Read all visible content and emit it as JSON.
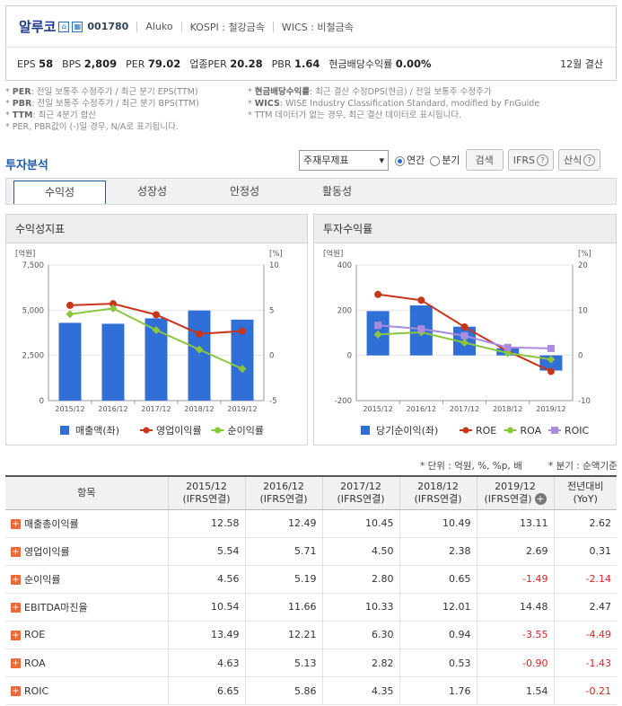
{
  "company": {
    "name": "알루코",
    "code": "001780",
    "eng": "Aluko",
    "market": "KOSPI : 철강금속",
    "wics": "WICS : 비철금속",
    "icon1": "home-icon",
    "icon2": "building-icon"
  },
  "summary": {
    "eps_label": "EPS",
    "eps": "58",
    "bps_label": "BPS",
    "bps": "2,809",
    "per_label": "PER",
    "per": "79.02",
    "iper_label": "업종PER",
    "iper": "20.28",
    "pbr_label": "PBR",
    "pbr": "1.64",
    "div_label": "현금배당수익률",
    "div": "0.00%",
    "fy": "12월 결산"
  },
  "notes_left": [
    {
      "k": "PER",
      "v": ": 전일 보통주 수정주가 / 최근 분기 EPS(TTM)"
    },
    {
      "k": "PBR",
      "v": ": 전일 보통주 수정주가 / 최근 분기 BPS(TTM)"
    },
    {
      "k": "TTM",
      "v": ": 최근 4분기 합산"
    },
    {
      "k": "",
      "v": "PER, PBR값이 (-)일 경우, N/A로 표기됩니다."
    }
  ],
  "notes_right": [
    {
      "k": "현금배당수익률",
      "v": ": 최근 결산 수정DPS(현금) / 전일 보통주 수정주가"
    },
    {
      "k": "WICS",
      "v": ": WISE Industry Classification Standard, modified by FnGuide"
    },
    {
      "k": "",
      "v": "TTM 데이터가 없는 경우, 최근 결산 데이터로 표시됩니다."
    }
  ],
  "section_title": "투자분석",
  "controls": {
    "select": "주재무제표",
    "annual": "연간",
    "quarter": "분기",
    "search": "검색",
    "ifrs": "IFRS",
    "formula": "산식",
    "q": "?"
  },
  "tabs": [
    "수익성",
    "성장성",
    "안정성",
    "활동성"
  ],
  "charts_titles": [
    "수익성지표",
    "투자수익률"
  ],
  "chart_data": [
    {
      "type": "bar",
      "title": "수익성지표",
      "categories": [
        "2015/12",
        "2016/12",
        "2017/12",
        "2018/12",
        "2019/12"
      ],
      "left_unit": "[억원]",
      "right_unit": "[%]",
      "yleft_ticks": [
        "7,500",
        "5,000",
        "2,500",
        "0"
      ],
      "yright_ticks": [
        "10",
        "5",
        "0",
        "-5"
      ],
      "ylim_left": [
        0,
        7500
      ],
      "ylim_right": [
        -5,
        10
      ],
      "series": [
        {
          "name": "매출액(좌)",
          "kind": "bar",
          "axis": "left",
          "color": "#2f6fd6",
          "values": [
            4300,
            4250,
            4550,
            4980,
            4480
          ]
        },
        {
          "name": "영업이익률",
          "kind": "line",
          "axis": "right",
          "color": "#c8361a",
          "values": [
            5.54,
            5.71,
            4.5,
            2.38,
            2.69
          ]
        },
        {
          "name": "순이익률",
          "kind": "line",
          "axis": "right",
          "color": "#8cc63e",
          "values": [
            4.56,
            5.19,
            2.8,
            0.65,
            -1.49
          ]
        }
      ]
    },
    {
      "type": "bar",
      "title": "투자수익률",
      "categories": [
        "2015/12",
        "2016/12",
        "2017/12",
        "2018/12",
        "2019/12"
      ],
      "left_unit": "[억원]",
      "right_unit": "[%]",
      "yleft_ticks": [
        "400",
        "200",
        "0",
        "-200"
      ],
      "yright_ticks": [
        "20",
        "10",
        "0",
        "-10"
      ],
      "ylim_left": [
        -200,
        400
      ],
      "ylim_right": [
        -10,
        20
      ],
      "series": [
        {
          "name": "당기순이익(좌)",
          "kind": "bar",
          "axis": "left",
          "color": "#2f6fd6",
          "values": [
            196,
            221,
            127,
            32,
            -67
          ]
        },
        {
          "name": "ROE",
          "kind": "line",
          "axis": "right",
          "color": "#c8361a",
          "values": [
            13.49,
            12.21,
            6.3,
            0.94,
            -3.55
          ]
        },
        {
          "name": "ROA",
          "kind": "line",
          "axis": "right",
          "color": "#8cc63e",
          "values": [
            4.63,
            5.13,
            2.82,
            0.53,
            -0.9
          ]
        },
        {
          "name": "ROIC",
          "kind": "line",
          "axis": "right",
          "color": "#a98be0",
          "values": [
            6.65,
            5.86,
            4.35,
            1.76,
            1.54
          ]
        }
      ]
    }
  ],
  "table_note_left": "* 단위 : 억원, %, %p, 배",
  "table_note_right": "* 분기 : 순액기준",
  "table": {
    "headers": [
      "항목",
      "2015/12\n(IFRS연결)",
      "2016/12\n(IFRS연결)",
      "2017/12\n(IFRS연결)",
      "2018/12\n(IFRS연결)",
      "2019/12\n(IFRS연결)",
      "전년대비\n(YoY)"
    ],
    "rows": [
      [
        "매출총이익률",
        "12.58",
        "12.49",
        "10.45",
        "10.49",
        "13.11",
        "2.62"
      ],
      [
        "영업이익률",
        "5.54",
        "5.71",
        "4.50",
        "2.38",
        "2.69",
        "0.31"
      ],
      [
        "순이익률",
        "4.56",
        "5.19",
        "2.80",
        "0.65",
        "-1.49",
        "-2.14"
      ],
      [
        "EBITDA마진율",
        "10.54",
        "11.66",
        "10.33",
        "12.01",
        "14.48",
        "2.47"
      ],
      [
        "ROE",
        "13.49",
        "12.21",
        "6.30",
        "0.94",
        "-3.55",
        "-4.49"
      ],
      [
        "ROA",
        "4.63",
        "5.13",
        "2.82",
        "0.53",
        "-0.90",
        "-1.43"
      ],
      [
        "ROIC",
        "6.65",
        "5.86",
        "4.35",
        "1.76",
        "1.54",
        "-0.21"
      ]
    ]
  }
}
